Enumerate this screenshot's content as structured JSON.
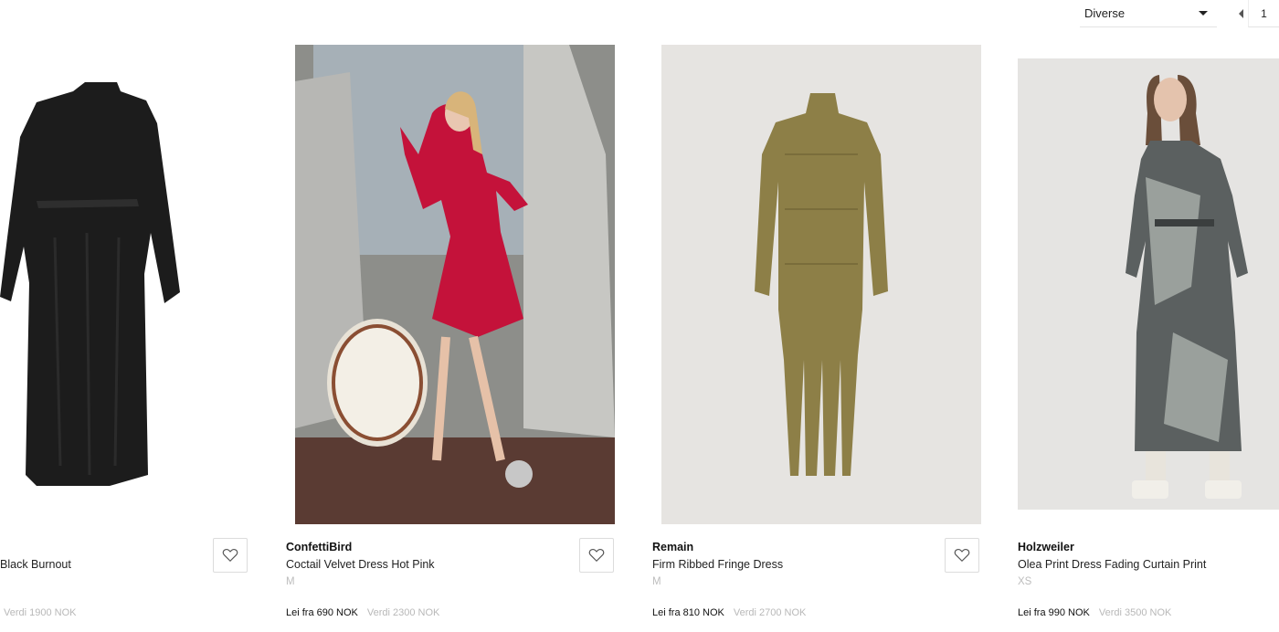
{
  "sort": {
    "selected": "Diverse"
  },
  "pagination": {
    "current_page": "1"
  },
  "products": [
    {
      "brand": "",
      "title": "Black Burnout",
      "size": "",
      "rent_price": "",
      "value_price": "Verdi 1900 NOK",
      "image": "black-dress-flatlay",
      "background": "#ffffff"
    },
    {
      "brand": "ConfettiBird",
      "title": "Coctail Velvet Dress Hot Pink",
      "size": "M",
      "rent_price": "Lei fra 690 NOK",
      "value_price": "Verdi 2300 NOK",
      "image": "pink-dress-model-photo",
      "background": "#8a8a86"
    },
    {
      "brand": "Remain",
      "title": "Firm Ribbed Fringe Dress",
      "size": "M",
      "rent_price": "Lei fra 810 NOK",
      "value_price": "Verdi 2700 NOK",
      "image": "olive-knit-dress",
      "background": "#e6e4e1"
    },
    {
      "brand": "Holzweiler",
      "title": "Olea Print Dress Fading Curtain Print",
      "size": "XS",
      "rent_price": "Lei fra 990 NOK",
      "value_price": "Verdi 3500 NOK",
      "image": "print-dress-model",
      "background": "#e5e4e2"
    }
  ]
}
